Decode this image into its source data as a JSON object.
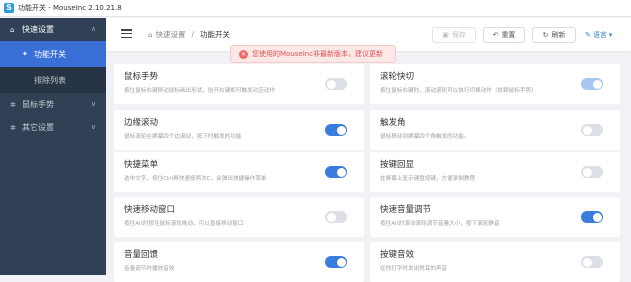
{
  "titlebar": {
    "title": "功能开关 - MouseInc 2.10.21.8"
  },
  "sidebar": {
    "items": [
      {
        "icon": "home-icon",
        "label": "快速设置",
        "expanded": true
      },
      {
        "icon": "gear-icon",
        "label": "鼠标手势",
        "expanded": false
      },
      {
        "icon": "gear-icon",
        "label": "其它设置",
        "expanded": false
      }
    ],
    "subitems": [
      {
        "label": "功能开关",
        "active": true
      },
      {
        "label": "排除列表",
        "active": false
      }
    ]
  },
  "header": {
    "breadcrumb": {
      "home": "快速设置",
      "current": "功能开关"
    },
    "save_label": "保存",
    "reset_label": "重置",
    "refresh_label": "刷新",
    "lang_label": "语言"
  },
  "notice": {
    "text": "您使用的MouseInc非最新版本，建议更新"
  },
  "features": [
    {
      "title": "鼠标手势",
      "desc": "按住鼠标右键移动鼠标画出形状，抬开右键即可触发对应动作",
      "state": "off"
    },
    {
      "title": "滚轮快切",
      "desc": "按住鼠标右键时，滚动滚轮可以执行切换动作（依赖鼠标手势）",
      "state": "on-disabled"
    },
    {
      "title": "边缘滚动",
      "desc": "鼠标滚轮在屏幕四个边滚动，按下时触发的功能",
      "state": "on"
    },
    {
      "title": "触发角",
      "desc": "鼠标移动到屏幕四个角触发的功能。",
      "state": "off"
    },
    {
      "title": "快捷菜单",
      "desc": "选中文字，按住Ctrl再快速按两次C，会弹出快捷操作菜单",
      "state": "on"
    },
    {
      "title": "按键回显",
      "desc": "在屏幕上显示键盘按键，方便录制教程",
      "state": "off"
    },
    {
      "title": "快速移动窗口",
      "desc": "按住Alt时按住鼠标滚轮拖动，可以直接移动窗口",
      "state": "off"
    },
    {
      "title": "快速音量调节",
      "desc": "按住Alt时滚动滚轮调节音量大小，按下滚轮静音",
      "state": "on"
    },
    {
      "title": "音量回馈",
      "desc": "音量调节时播放音效",
      "state": "on"
    },
    {
      "title": "按键音效",
      "desc": "在你打字时发出悦耳的声音",
      "state": "off"
    }
  ]
}
